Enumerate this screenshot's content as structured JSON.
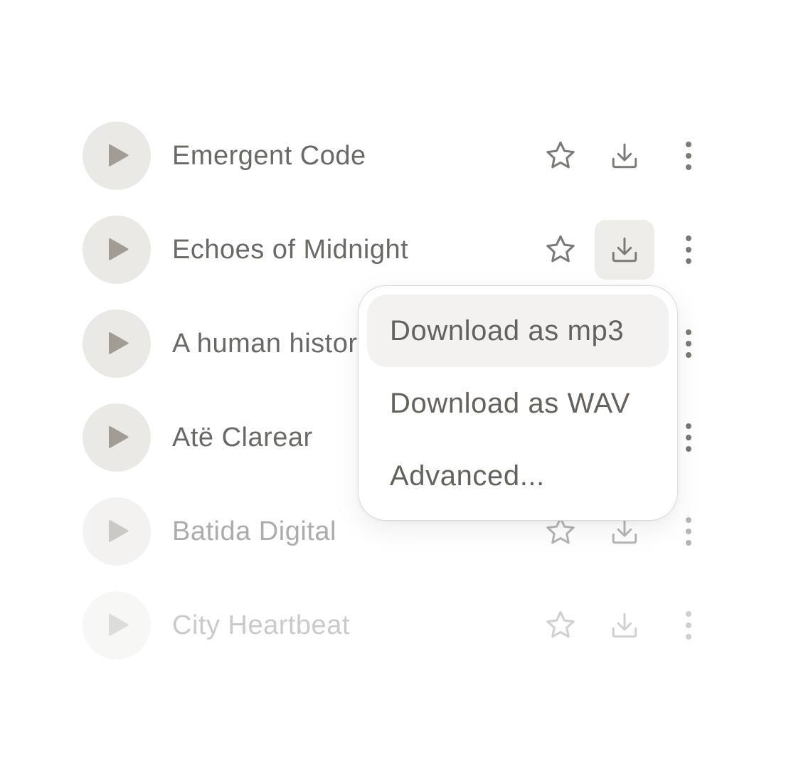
{
  "tracks": [
    {
      "title": "Emergent Code"
    },
    {
      "title": "Echoes of Midnight"
    },
    {
      "title": "A human history"
    },
    {
      "title": "Atë Clarear"
    },
    {
      "title": "Batida Digital"
    },
    {
      "title": "City Heartbeat"
    }
  ],
  "icons": {
    "play": "play-icon",
    "star": "star-icon",
    "download": "download-icon",
    "more": "more-vertical-icon"
  },
  "download_menu": {
    "items": [
      {
        "label": "Download as mp3"
      },
      {
        "label": "Download as WAV"
      },
      {
        "label": "Advanced..."
      }
    ]
  },
  "colors": {
    "text": "#6b6966",
    "icon": "#7c7a77",
    "play_fill": "#a29d94",
    "play_bg": "#ebe9e6",
    "active_bg": "#efedea",
    "menu_highlight": "#f3f2f0"
  }
}
